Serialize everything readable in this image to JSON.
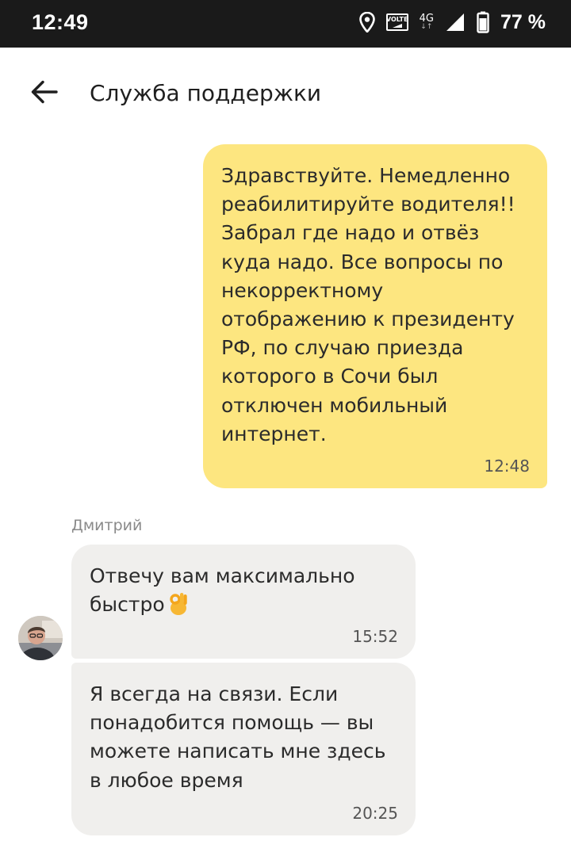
{
  "status_bar": {
    "time": "12:49",
    "volte_label": "VOLTE",
    "network": "4G",
    "battery_percent": "77 %"
  },
  "header": {
    "title": "Служба поддержки"
  },
  "messages": [
    {
      "direction": "outgoing",
      "text": "Здравствуйте. Немедленно реабилитируйте водителя!! Забрал где надо и отвёз куда надо. Все вопросы по некорректному отображению к президенту РФ, по случаю приезда которого в Сочи был отключен мобильный интернет.",
      "time": "12:48"
    },
    {
      "direction": "incoming",
      "sender": "Дмитрий",
      "text": "Отвечу вам максимально быстро",
      "emoji": "ok-hand",
      "time": "15:52"
    },
    {
      "direction": "incoming",
      "text": "Я всегда на связи. Если понадобится помощь — вы можете написать мне здесь в любое время",
      "time": "20:25"
    }
  ],
  "colors": {
    "status_bar_bg": "#1a1a1a",
    "outgoing_bubble": "#fde680",
    "incoming_bubble": "#f0efed",
    "sender_name": "#8a8a8a"
  },
  "icons": [
    "location-icon",
    "volte-icon",
    "network-4g-icon",
    "signal-icon",
    "battery-icon",
    "back-arrow-icon",
    "ok-hand-emoji-icon"
  ]
}
